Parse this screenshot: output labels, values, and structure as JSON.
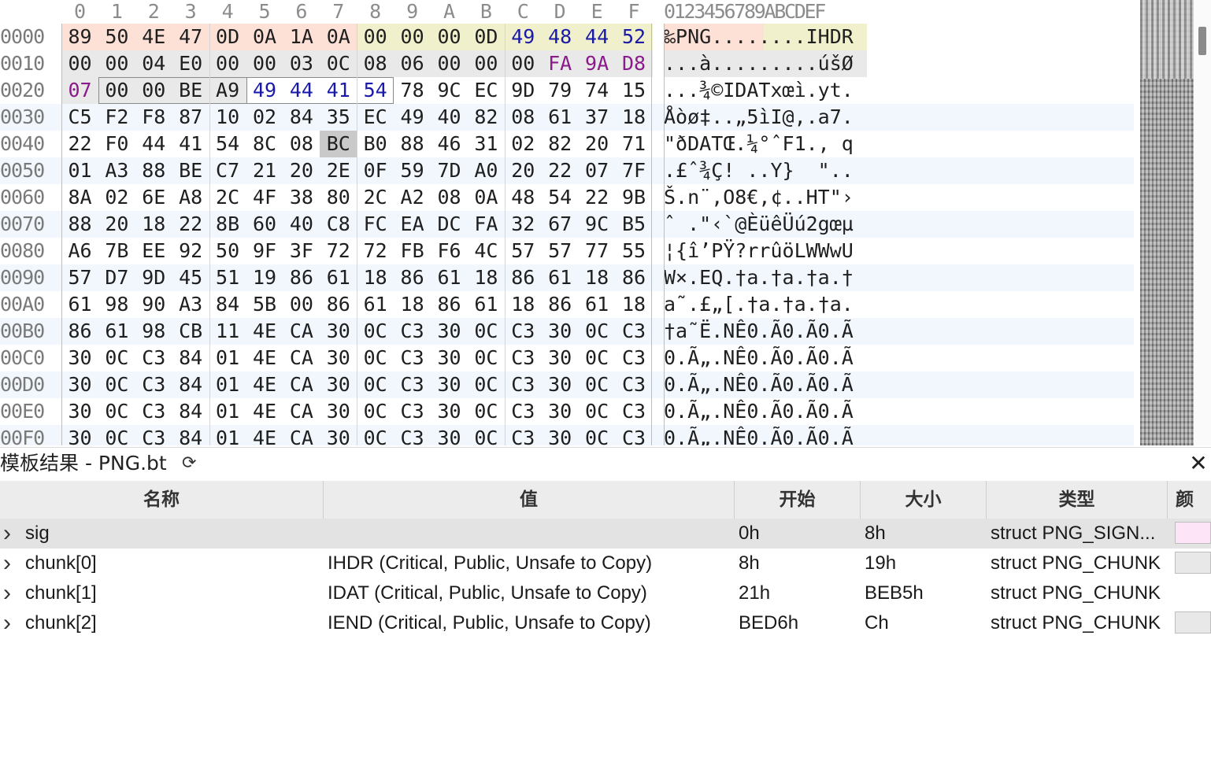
{
  "hex_editor": {
    "column_headers": [
      "0",
      "1",
      "2",
      "3",
      "4",
      "5",
      "6",
      "7",
      "8",
      "9",
      "A",
      "B",
      "C",
      "D",
      "E",
      "F"
    ],
    "ascii_header": "0123456789ABCDEF",
    "rows": [
      {
        "addr": "0000",
        "bytes": [
          "89",
          "50",
          "4E",
          "47",
          "0D",
          "0A",
          "1A",
          "0A",
          "00",
          "00",
          "00",
          "0D",
          "49",
          "48",
          "44",
          "52"
        ],
        "ascii": "‰PNG........IHDR"
      },
      {
        "addr": "0010",
        "bytes": [
          "00",
          "00",
          "04",
          "E0",
          "00",
          "00",
          "03",
          "0C",
          "08",
          "06",
          "00",
          "00",
          "00",
          "FA",
          "9A",
          "D8"
        ],
        "ascii": "...à.........úšØ"
      },
      {
        "addr": "0020",
        "bytes": [
          "07",
          "00",
          "00",
          "BE",
          "A9",
          "49",
          "44",
          "41",
          "54",
          "78",
          "9C",
          "EC",
          "9D",
          "79",
          "74",
          "15"
        ],
        "ascii": "...¾©IDATxœì.yt."
      },
      {
        "addr": "0030",
        "bytes": [
          "C5",
          "F2",
          "F8",
          "87",
          "10",
          "02",
          "84",
          "35",
          "EC",
          "49",
          "40",
          "82",
          "08",
          "61",
          "37",
          "18"
        ],
        "ascii": "Åòø‡..„5ìI@‚.a7."
      },
      {
        "addr": "0040",
        "bytes": [
          "22",
          "F0",
          "44",
          "41",
          "54",
          "8C",
          "08",
          "BC",
          "B0",
          "88",
          "46",
          "31",
          "02",
          "82",
          "20",
          "71"
        ],
        "ascii": "\"ðDATŒ.¼°ˆF1.‚ q"
      },
      {
        "addr": "0050",
        "bytes": [
          "01",
          "A3",
          "88",
          "BE",
          "C7",
          "21",
          "20",
          "2E",
          "0F",
          "59",
          "7D",
          "A0",
          "20",
          "22",
          "07",
          "7F"
        ],
        "ascii": ".£ˆ¾Ç! ..Y}  \".."
      },
      {
        "addr": "0060",
        "bytes": [
          "8A",
          "02",
          "6E",
          "A8",
          "2C",
          "4F",
          "38",
          "80",
          "2C",
          "A2",
          "08",
          "0A",
          "48",
          "54",
          "22",
          "9B"
        ],
        "ascii": "Š.n¨,O8€,¢..HT\"›"
      },
      {
        "addr": "0070",
        "bytes": [
          "88",
          "20",
          "18",
          "22",
          "8B",
          "60",
          "40",
          "C8",
          "FC",
          "EA",
          "DC",
          "FA",
          "32",
          "67",
          "9C",
          "B5"
        ],
        "ascii": "ˆ .\"‹`@ÈüêÜú2gœµ"
      },
      {
        "addr": "0080",
        "bytes": [
          "A6",
          "7B",
          "EE",
          "92",
          "50",
          "9F",
          "3F",
          "72",
          "72",
          "FB",
          "F6",
          "4C",
          "57",
          "57",
          "77",
          "55"
        ],
        "ascii": "¦{î’PŸ?rrûöLWWwU"
      },
      {
        "addr": "0090",
        "bytes": [
          "57",
          "D7",
          "9D",
          "45",
          "51",
          "19",
          "86",
          "61",
          "18",
          "86",
          "61",
          "18",
          "86",
          "61",
          "18",
          "86"
        ],
        "ascii": "W×.EQ.†a.†a.†a.†"
      },
      {
        "addr": "00A0",
        "bytes": [
          "61",
          "98",
          "90",
          "A3",
          "84",
          "5B",
          "00",
          "86",
          "61",
          "18",
          "86",
          "61",
          "18",
          "86",
          "61",
          "18"
        ],
        "ascii": "a˜.£„[.†a.†a.†a."
      },
      {
        "addr": "00B0",
        "bytes": [
          "86",
          "61",
          "98",
          "CB",
          "11",
          "4E",
          "CA",
          "30",
          "0C",
          "C3",
          "30",
          "0C",
          "C3",
          "30",
          "0C",
          "C3"
        ],
        "ascii": "†a˜Ë.NÊ0.Ã0.Ã0.Ã"
      },
      {
        "addr": "00C0",
        "bytes": [
          "30",
          "0C",
          "C3",
          "84",
          "01",
          "4E",
          "CA",
          "30",
          "0C",
          "C3",
          "30",
          "0C",
          "C3",
          "30",
          "0C",
          "C3"
        ],
        "ascii": "0.Ã„.NÊ0.Ã0.Ã0.Ã"
      },
      {
        "addr": "00D0",
        "bytes": [
          "30",
          "0C",
          "C3",
          "84",
          "01",
          "4E",
          "CA",
          "30",
          "0C",
          "C3",
          "30",
          "0C",
          "C3",
          "30",
          "0C",
          "C3"
        ],
        "ascii": "0.Ã„.NÊ0.Ã0.Ã0.Ã"
      },
      {
        "addr": "00E0",
        "bytes": [
          "30",
          "0C",
          "C3",
          "84",
          "01",
          "4E",
          "CA",
          "30",
          "0C",
          "C3",
          "30",
          "0C",
          "C3",
          "30",
          "0C",
          "C3"
        ],
        "ascii": "0.Ã„.NÊ0.Ã0.Ã0.Ã"
      },
      {
        "addr": "00F0",
        "bytes": [
          "30",
          "0C",
          "C3",
          "84",
          "01",
          "4E",
          "CA",
          "30",
          "0C",
          "C3",
          "30",
          "0C",
          "C3",
          "30",
          "0C",
          "C3"
        ],
        "ascii": "0.Ã„.NÊ0.Ã0.Ã0.Ã"
      }
    ],
    "colors": {
      "sig_bg": "#fde0d6",
      "length_bg": "#f1f0cc",
      "type_text": "#1a1aa8",
      "crc_text": "#8b1a8b",
      "chunk_data_bg": "#e9e9e9",
      "highlight_cell_bg": "#c9c9c9",
      "alt_row_bg": "#f2f7fd"
    }
  },
  "template_results": {
    "title": "模板结果 - PNG.bt",
    "refresh_icon": "refresh-icon",
    "close_icon": "close-icon",
    "columns": [
      "名称",
      "值",
      "开始",
      "大小",
      "类型",
      "颜"
    ],
    "rows": [
      {
        "name": "sig",
        "value": "",
        "start": "0h",
        "size": "8h",
        "type": "struct PNG_SIGN...",
        "color": "#fde4f7",
        "selected": true
      },
      {
        "name": "chunk[0]",
        "value": "IHDR  (Critical, Public, Unsafe to Copy)",
        "start": "8h",
        "size": "19h",
        "type": "struct PNG_CHUNK",
        "color": "#e8e8e8",
        "selected": false
      },
      {
        "name": "chunk[1]",
        "value": "IDAT  (Critical, Public, Unsafe to Copy)",
        "start": "21h",
        "size": "BEB5h",
        "type": "struct PNG_CHUNK",
        "color": "#ffffff",
        "selected": false
      },
      {
        "name": "chunk[2]",
        "value": "IEND  (Critical, Public, Unsafe to Copy)",
        "start": "BED6h",
        "size": "Ch",
        "type": "struct PNG_CHUNK",
        "color": "#e8e8e8",
        "selected": false
      }
    ]
  }
}
